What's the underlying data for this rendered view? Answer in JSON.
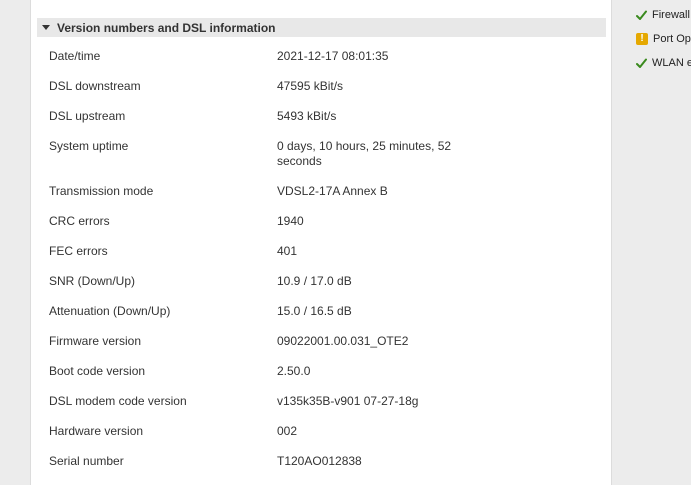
{
  "section": {
    "title": "Version numbers and DSL information"
  },
  "rows": [
    {
      "label": "Date/time",
      "value": "2021-12-17 08:01:35"
    },
    {
      "label": "DSL downstream",
      "value": "47595 kBit/s"
    },
    {
      "label": "DSL upstream",
      "value": "5493 kBit/s"
    },
    {
      "label": "System uptime",
      "value": "0 days, 10 hours, 25 minutes, 52 seconds"
    },
    {
      "label": "Transmission mode",
      "value": "VDSL2-17A Annex B"
    },
    {
      "label": "CRC errors",
      "value": "1940"
    },
    {
      "label": "FEC errors",
      "value": "401"
    },
    {
      "label": "SNR (Down/Up)",
      "value": "10.9 / 17.0 dB"
    },
    {
      "label": "Attenuation (Down/Up)",
      "value": "15.0 / 16.5 dB"
    },
    {
      "label": "Firmware version",
      "value": "09022001.00.031_OTE2"
    },
    {
      "label": "Boot code version",
      "value": "2.50.0"
    },
    {
      "label": "DSL modem code version",
      "value": "v135k35B-v901 07-27-18g"
    },
    {
      "label": "Hardware version",
      "value": "002"
    },
    {
      "label": "Serial number",
      "value": "T120AO012838"
    }
  ],
  "status_panel": {
    "items": [
      {
        "text": "Firewall",
        "icon": "check-icon",
        "color": "#3a8a1e"
      },
      {
        "text": "Port Ope",
        "icon": "warning-icon",
        "color": "#e5a800"
      },
      {
        "text": "WLAN e",
        "icon": "check-icon",
        "color": "#3a8a1e"
      }
    ]
  }
}
